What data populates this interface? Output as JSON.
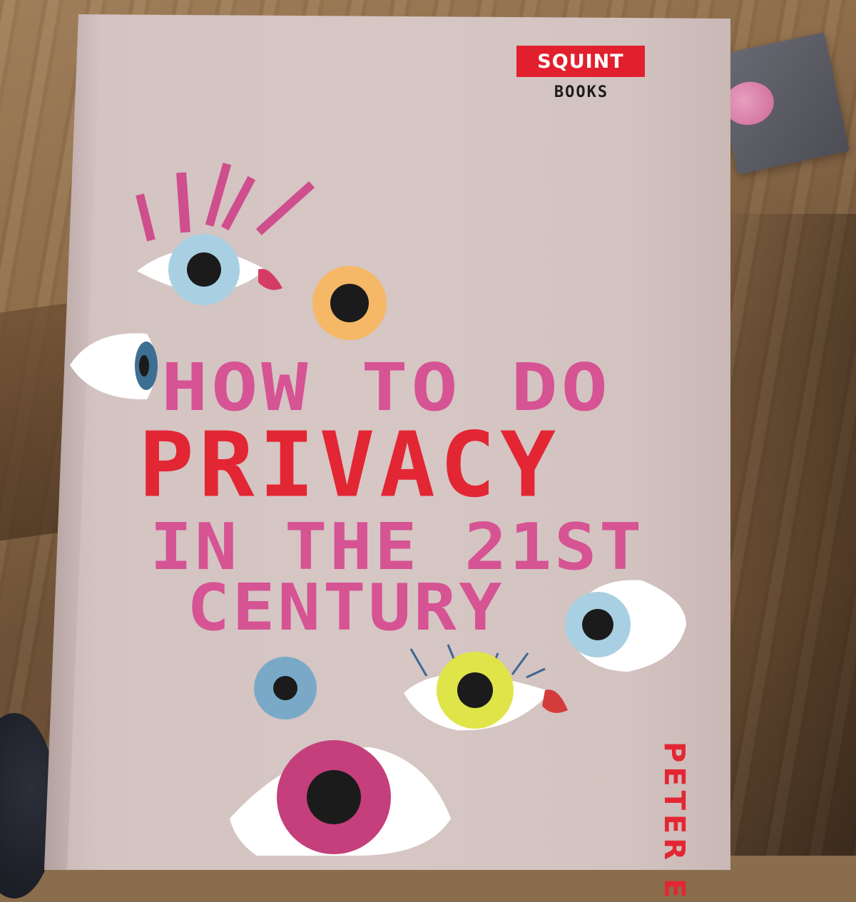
{
  "publisher": {
    "name": "SQUINT",
    "sub": "BOOKS",
    "color": "#e2202d"
  },
  "title": {
    "line1": "HOW TO DO",
    "line2": "PRIVACY",
    "line3": "IN THE 21ST",
    "line4": "CENTURY"
  },
  "author": {
    "visible_text": "PETER E"
  },
  "colors": {
    "cover": "#d6c6c4",
    "pink": "#d65394",
    "red": "#e32634",
    "table": "#8a6d4d"
  },
  "illustration": {
    "icons": [
      "eye-icon",
      "eye-icon",
      "eye-icon",
      "eye-icon",
      "eye-icon",
      "eye-icon",
      "eye-icon",
      "eye-icon"
    ]
  }
}
